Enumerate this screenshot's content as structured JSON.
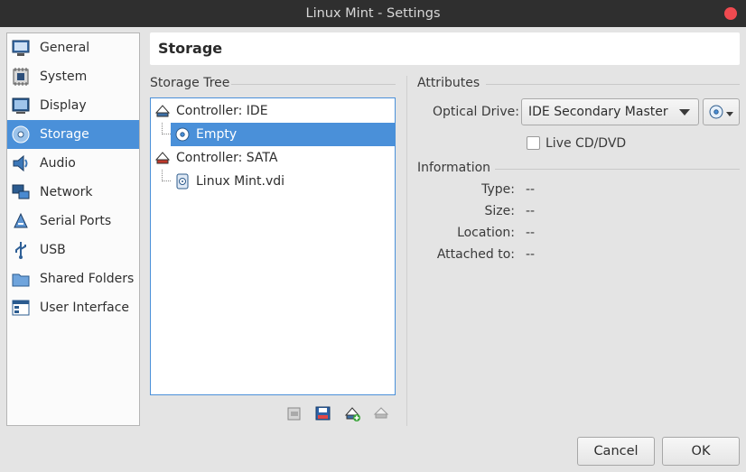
{
  "window": {
    "title": "Linux Mint - Settings"
  },
  "sidebar": {
    "items": [
      {
        "label": "General",
        "icon": "general-icon"
      },
      {
        "label": "System",
        "icon": "system-icon"
      },
      {
        "label": "Display",
        "icon": "display-icon"
      },
      {
        "label": "Storage",
        "icon": "storage-icon",
        "active": true
      },
      {
        "label": "Audio",
        "icon": "audio-icon"
      },
      {
        "label": "Network",
        "icon": "network-icon"
      },
      {
        "label": "Serial Ports",
        "icon": "serial-ports-icon"
      },
      {
        "label": "USB",
        "icon": "usb-icon"
      },
      {
        "label": "Shared Folders",
        "icon": "shared-folders-icon"
      },
      {
        "label": "User Interface",
        "icon": "user-interface-icon"
      }
    ]
  },
  "page": {
    "title": "Storage"
  },
  "storage_tree": {
    "label": "Storage Tree",
    "nodes": [
      {
        "label": "Controller: IDE",
        "kind": "controller"
      },
      {
        "label": "Empty",
        "kind": "optical",
        "selected": true
      },
      {
        "label": "Controller: SATA",
        "kind": "controller"
      },
      {
        "label": "Linux Mint.vdi",
        "kind": "disk"
      }
    ],
    "toolbar": [
      "storage-settings-icon",
      "add-controller-icon",
      "add-attachment-icon",
      "remove-icon"
    ]
  },
  "attributes": {
    "label": "Attributes",
    "optical_drive_label": "Optical Drive:",
    "optical_drive_value": "IDE Secondary Master",
    "live_cd_label": "Live CD/DVD",
    "live_cd_checked": false
  },
  "information": {
    "label": "Information",
    "rows": [
      {
        "key": "Type:",
        "value": "--"
      },
      {
        "key": "Size:",
        "value": "--"
      },
      {
        "key": "Location:",
        "value": "--"
      },
      {
        "key": "Attached to:",
        "value": "--"
      }
    ]
  },
  "buttons": {
    "cancel": "Cancel",
    "ok": "OK"
  },
  "colors": {
    "accent": "#4a90d9",
    "titlebar": "#2f2f2f",
    "close": "#f04a50"
  }
}
